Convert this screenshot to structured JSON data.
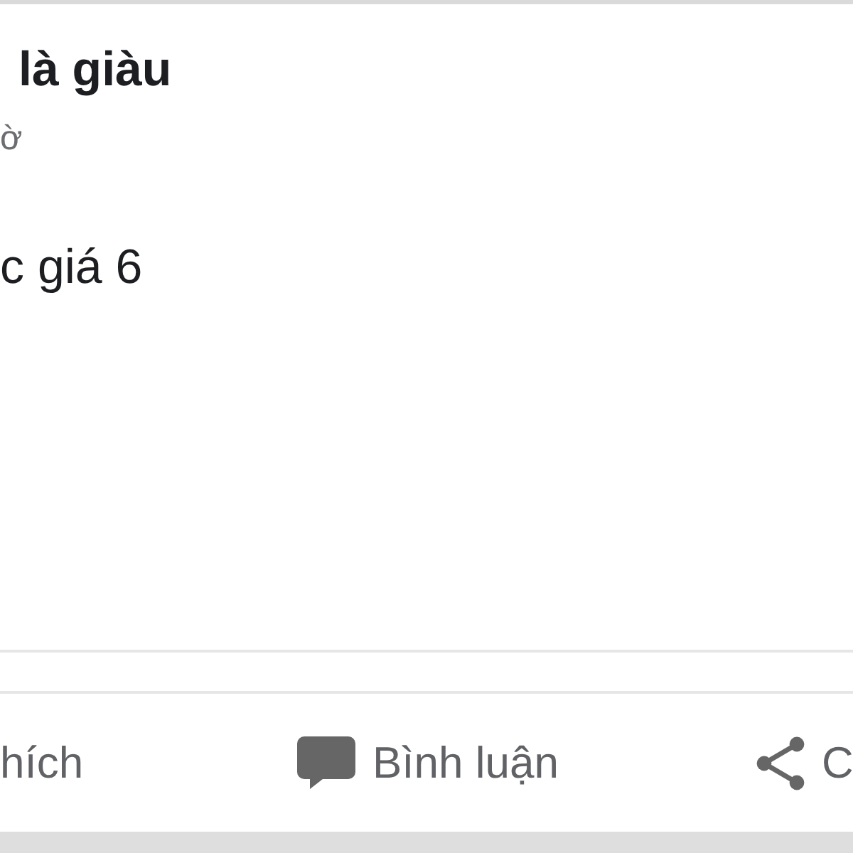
{
  "post": {
    "author": "là giàu",
    "time": "ờ",
    "text": "c giá 6"
  },
  "actions": [
    {
      "kind": "like",
      "label": "hích"
    },
    {
      "kind": "comment",
      "label": "Bình luận"
    },
    {
      "kind": "share",
      "label": "C"
    }
  ]
}
